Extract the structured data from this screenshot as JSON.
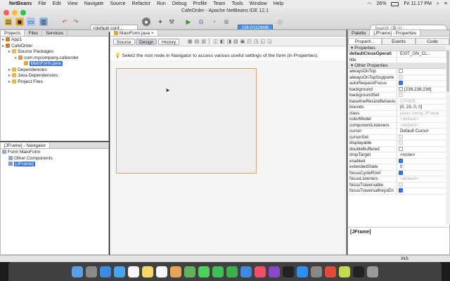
{
  "menubar": {
    "apple": "",
    "items": [
      "NetBeans",
      "File",
      "Edit",
      "View",
      "Navigate",
      "Source",
      "Refactor",
      "Run",
      "Debug",
      "Profile",
      "Team",
      "Tools",
      "Window",
      "Help"
    ],
    "battery": "26%",
    "clock": "Fri 11.17 PM"
  },
  "window": {
    "title": "CafeOrder - Apache NetBeans IDE 12.1",
    "config": "<default conf...",
    "memory": "138.0/1128MB",
    "search_placeholder": "Search (⌘+I)"
  },
  "projects": {
    "tabs": [
      "Projects",
      "Files",
      "Services"
    ],
    "tree": [
      {
        "label": "App1",
        "indent": 0,
        "type": "project"
      },
      {
        "label": "CafeOrder",
        "indent": 0,
        "type": "project"
      },
      {
        "label": "Source Packages",
        "indent": 1,
        "type": "folder"
      },
      {
        "label": "com.mycompany.cafeorder",
        "indent": 2,
        "type": "package"
      },
      {
        "label": "MainForm.java",
        "indent": 3,
        "type": "file",
        "selected": true
      },
      {
        "label": "Dependencies",
        "indent": 1,
        "type": "folder"
      },
      {
        "label": "Java Dependencies",
        "indent": 1,
        "type": "folder"
      },
      {
        "label": "Project Files",
        "indent": 1,
        "type": "folder"
      }
    ]
  },
  "navigator": {
    "title": "[JFrame] - Navigator",
    "tree": [
      {
        "label": "Form MainForm",
        "indent": 0
      },
      {
        "label": "Other Components",
        "indent": 1
      },
      {
        "label": "[JFrame]",
        "indent": 1,
        "selected": true
      }
    ]
  },
  "editor": {
    "tab": "MainForm.java",
    "modes": [
      "Source",
      "Design",
      "History"
    ],
    "active_mode": "Design",
    "hint": "Select the root node in Navigator to access various useful settings of the form (in Properties)."
  },
  "properties": {
    "panel_tabs": [
      "Palette",
      "[JFrame] - Properties"
    ],
    "tabs": [
      "Properti...",
      "Events",
      "Code"
    ],
    "group1": "Properties",
    "group2": "Other Properties",
    "rows1": [
      {
        "name": "defaultCloseOperati",
        "value": "EXIT_ON_CL...",
        "bold": true
      },
      {
        "name": "title",
        "value": ""
      }
    ],
    "rows2": [
      {
        "name": "alwaysOnTop",
        "value": "",
        "cb": "off"
      },
      {
        "name": "alwaysOnTopSupporte",
        "value": "",
        "cb": "dis"
      },
      {
        "name": "autoRequestFocus",
        "value": "",
        "cb": "on"
      },
      {
        "name": "background",
        "value": "[238,238,238]",
        "cb": "swatch"
      },
      {
        "name": "backgroundSet",
        "value": "",
        "cb": "dis"
      },
      {
        "name": "baselineResizeBehavio",
        "value": "OTHER",
        "dim": true
      },
      {
        "name": "bounds",
        "value": "[0, 23, 0, 0]"
      },
      {
        "name": "class",
        "value": "javax.swing.JFrame",
        "dim": true
      },
      {
        "name": "colorModel",
        "value": "<default>",
        "dim": true
      },
      {
        "name": "componentListeners",
        "value": "<default>",
        "dim": true
      },
      {
        "name": "cursor",
        "value": "Default Cursor"
      },
      {
        "name": "cursorSet",
        "value": "",
        "cb": "dis"
      },
      {
        "name": "displayable",
        "value": "",
        "cb": "dis"
      },
      {
        "name": "doubleBuffered",
        "value": "",
        "cb": "off"
      },
      {
        "name": "dropTarget",
        "value": "<none>"
      },
      {
        "name": "enabled",
        "value": "",
        "cb": "on"
      },
      {
        "name": "extendedState",
        "value": "0"
      },
      {
        "name": "focusCycleRoot",
        "value": "",
        "cb": "on"
      },
      {
        "name": "focusListeners",
        "value": "<default>",
        "dim": true
      },
      {
        "name": "focusTraversable",
        "value": "",
        "cb": "dis"
      },
      {
        "name": "focusTraversalKeysEn",
        "value": "",
        "cb": "on"
      }
    ],
    "footer": "[JFrame]"
  },
  "status": {
    "mode": "INS"
  },
  "dock": [
    "finder",
    "launchpad",
    "safari",
    "mail",
    "calendar",
    "notes",
    "reminders",
    "photos",
    "maps",
    "messages",
    "facetime",
    "numbers",
    "keynote",
    "music",
    "podcasts",
    "tv",
    "app-store",
    "system-prefs",
    "chrome",
    "netbeans",
    "terminal",
    "trash"
  ]
}
